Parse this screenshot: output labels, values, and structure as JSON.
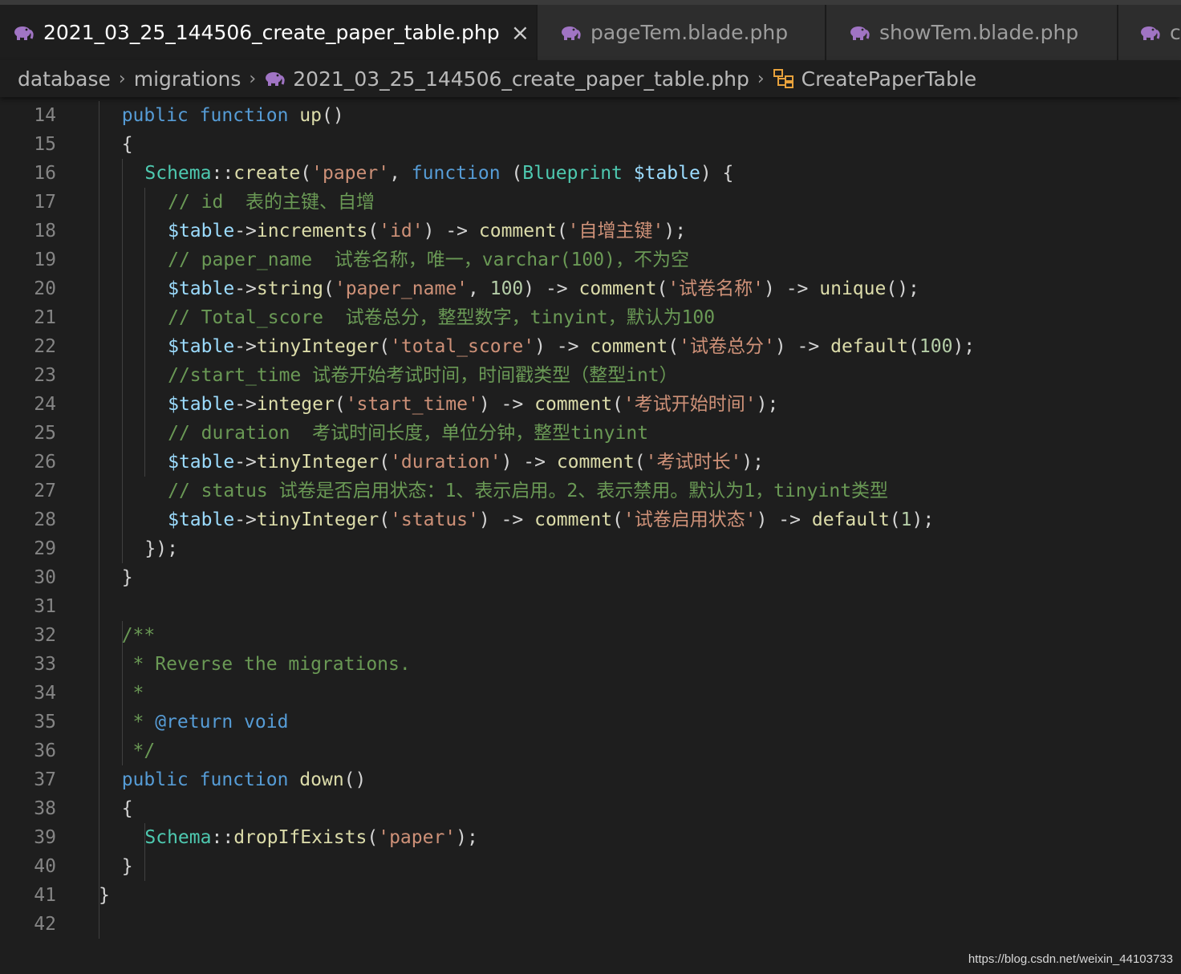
{
  "tabs": [
    {
      "label": "2021_03_25_144506_create_paper_table.php",
      "active": true,
      "icon": "php-elephant-icon"
    },
    {
      "label": "pageTem.blade.php",
      "active": false,
      "icon": "php-elephant-icon"
    },
    {
      "label": "showTem.blade.php",
      "active": false,
      "icon": "php-elephant-icon"
    },
    {
      "label": "c",
      "active": false,
      "icon": "php-elephant-icon"
    }
  ],
  "tab_close_glyph": "×",
  "breadcrumb": {
    "items": [
      "database",
      "migrations",
      "2021_03_25_144506_create_paper_table.php",
      "CreatePaperTable"
    ],
    "separator": "›"
  },
  "code_lines": [
    {
      "num": "14",
      "indent": 2,
      "tokens": [
        [
          "kw",
          "public"
        ],
        [
          "pn",
          " "
        ],
        [
          "kw",
          "function"
        ],
        [
          "pn",
          " "
        ],
        [
          "fn",
          "up"
        ],
        [
          "pn",
          "()"
        ]
      ]
    },
    {
      "num": "15",
      "indent": 2,
      "tokens": [
        [
          "pn",
          "{"
        ]
      ]
    },
    {
      "num": "16",
      "indent": 4,
      "tokens": [
        [
          "cls",
          "Schema"
        ],
        [
          "pn",
          "::"
        ],
        [
          "fn",
          "create"
        ],
        [
          "pn",
          "("
        ],
        [
          "str",
          "'paper'"
        ],
        [
          "pn",
          ", "
        ],
        [
          "kw",
          "function"
        ],
        [
          "pn",
          " ("
        ],
        [
          "cls",
          "Blueprint"
        ],
        [
          "pn",
          " "
        ],
        [
          "var",
          "$table"
        ],
        [
          "pn",
          ") {"
        ]
      ]
    },
    {
      "num": "17",
      "indent": 6,
      "tokens": [
        [
          "cm",
          "// id  表的主键、自增"
        ]
      ]
    },
    {
      "num": "18",
      "indent": 6,
      "tokens": [
        [
          "var",
          "$table"
        ],
        [
          "pn",
          "->"
        ],
        [
          "fn",
          "increments"
        ],
        [
          "pn",
          "("
        ],
        [
          "str",
          "'id'"
        ],
        [
          "pn",
          ") -> "
        ],
        [
          "fn",
          "comment"
        ],
        [
          "pn",
          "("
        ],
        [
          "str",
          "'自增主键'"
        ],
        [
          "pn",
          ");"
        ]
      ]
    },
    {
      "num": "19",
      "indent": 6,
      "tokens": [
        [
          "cm",
          "// paper_name  试卷名称，唯一，varchar(100)，不为空"
        ]
      ]
    },
    {
      "num": "20",
      "indent": 6,
      "tokens": [
        [
          "var",
          "$table"
        ],
        [
          "pn",
          "->"
        ],
        [
          "fn",
          "string"
        ],
        [
          "pn",
          "("
        ],
        [
          "str",
          "'paper_name'"
        ],
        [
          "pn",
          ", "
        ],
        [
          "num",
          "100"
        ],
        [
          "pn",
          ") -> "
        ],
        [
          "fn",
          "comment"
        ],
        [
          "pn",
          "("
        ],
        [
          "str",
          "'试卷名称'"
        ],
        [
          "pn",
          ") -> "
        ],
        [
          "fn",
          "unique"
        ],
        [
          "pn",
          "();"
        ]
      ]
    },
    {
      "num": "21",
      "indent": 6,
      "tokens": [
        [
          "cm",
          "// Total_score  试卷总分，整型数字，tinyint，默认为100"
        ]
      ]
    },
    {
      "num": "22",
      "indent": 6,
      "tokens": [
        [
          "var",
          "$table"
        ],
        [
          "pn",
          "->"
        ],
        [
          "fn",
          "tinyInteger"
        ],
        [
          "pn",
          "("
        ],
        [
          "str",
          "'total_score'"
        ],
        [
          "pn",
          ") -> "
        ],
        [
          "fn",
          "comment"
        ],
        [
          "pn",
          "("
        ],
        [
          "str",
          "'试卷总分'"
        ],
        [
          "pn",
          ") -> "
        ],
        [
          "fn",
          "default"
        ],
        [
          "pn",
          "("
        ],
        [
          "num",
          "100"
        ],
        [
          "pn",
          ");"
        ]
      ]
    },
    {
      "num": "23",
      "indent": 6,
      "tokens": [
        [
          "cm",
          "//start_time 试卷开始考试时间，时间戳类型（整型int）"
        ]
      ]
    },
    {
      "num": "24",
      "indent": 6,
      "tokens": [
        [
          "var",
          "$table"
        ],
        [
          "pn",
          "->"
        ],
        [
          "fn",
          "integer"
        ],
        [
          "pn",
          "("
        ],
        [
          "str",
          "'start_time'"
        ],
        [
          "pn",
          ") -> "
        ],
        [
          "fn",
          "comment"
        ],
        [
          "pn",
          "("
        ],
        [
          "str",
          "'考试开始时间'"
        ],
        [
          "pn",
          ");"
        ]
      ]
    },
    {
      "num": "25",
      "indent": 6,
      "tokens": [
        [
          "cm",
          "// duration  考试时间长度，单位分钟，整型tinyint"
        ]
      ]
    },
    {
      "num": "26",
      "indent": 6,
      "tokens": [
        [
          "var",
          "$table"
        ],
        [
          "pn",
          "->"
        ],
        [
          "fn",
          "tinyInteger"
        ],
        [
          "pn",
          "("
        ],
        [
          "str",
          "'duration'"
        ],
        [
          "pn",
          ") -> "
        ],
        [
          "fn",
          "comment"
        ],
        [
          "pn",
          "("
        ],
        [
          "str",
          "'考试时长'"
        ],
        [
          "pn",
          ");"
        ]
      ]
    },
    {
      "num": "27",
      "indent": 6,
      "tokens": [
        [
          "cm",
          "// status 试卷是否启用状态：1、表示启用。2、表示禁用。默认为1，tinyint类型"
        ]
      ]
    },
    {
      "num": "28",
      "indent": 6,
      "tokens": [
        [
          "var",
          "$table"
        ],
        [
          "pn",
          "->"
        ],
        [
          "fn",
          "tinyInteger"
        ],
        [
          "pn",
          "("
        ],
        [
          "str",
          "'status'"
        ],
        [
          "pn",
          ") -> "
        ],
        [
          "fn",
          "comment"
        ],
        [
          "pn",
          "("
        ],
        [
          "str",
          "'试卷启用状态'"
        ],
        [
          "pn",
          ") -> "
        ],
        [
          "fn",
          "default"
        ],
        [
          "pn",
          "("
        ],
        [
          "num",
          "1"
        ],
        [
          "pn",
          ");"
        ]
      ]
    },
    {
      "num": "29",
      "indent": 4,
      "tokens": [
        [
          "pn",
          "});"
        ]
      ]
    },
    {
      "num": "30",
      "indent": 2,
      "tokens": [
        [
          "pn",
          "}"
        ]
      ]
    },
    {
      "num": "31",
      "indent": 0,
      "tokens": []
    },
    {
      "num": "32",
      "indent": 2,
      "tokens": [
        [
          "cm",
          "/**"
        ]
      ]
    },
    {
      "num": "33",
      "indent": 2,
      "tokens": [
        [
          "cm",
          " * Reverse the migrations."
        ]
      ]
    },
    {
      "num": "34",
      "indent": 2,
      "tokens": [
        [
          "cm",
          " *"
        ]
      ]
    },
    {
      "num": "35",
      "indent": 2,
      "tokens": [
        [
          "cm",
          " * "
        ],
        [
          "kw",
          "@return"
        ],
        [
          "pn",
          " "
        ],
        [
          "kw",
          "void"
        ]
      ]
    },
    {
      "num": "36",
      "indent": 2,
      "tokens": [
        [
          "cm",
          " */"
        ]
      ]
    },
    {
      "num": "37",
      "indent": 2,
      "tokens": [
        [
          "kw",
          "public"
        ],
        [
          "pn",
          " "
        ],
        [
          "kw",
          "function"
        ],
        [
          "pn",
          " "
        ],
        [
          "fn",
          "down"
        ],
        [
          "pn",
          "()"
        ]
      ]
    },
    {
      "num": "38",
      "indent": 2,
      "tokens": [
        [
          "pn",
          "{"
        ]
      ]
    },
    {
      "num": "39",
      "indent": 4,
      "tokens": [
        [
          "cls",
          "Schema"
        ],
        [
          "pn",
          "::"
        ],
        [
          "fn",
          "dropIfExists"
        ],
        [
          "pn",
          "("
        ],
        [
          "str",
          "'paper'"
        ],
        [
          "pn",
          ");"
        ]
      ]
    },
    {
      "num": "40",
      "indent": 2,
      "tokens": [
        [
          "pn",
          "}"
        ]
      ]
    },
    {
      "num": "41",
      "indent": 0,
      "tokens": [
        [
          "pn",
          "}"
        ]
      ]
    },
    {
      "num": "42",
      "indent": 0,
      "tokens": []
    }
  ],
  "watermark": "https://blog.csdn.net/weixin_44103733",
  "colors": {
    "background": "#1e1e1e",
    "keyword": "#569cd6",
    "function": "#dcdcaa",
    "class": "#4ec9b0",
    "string": "#ce9178",
    "variable": "#9cdcfe",
    "number": "#b5cea8",
    "comment": "#6a9955",
    "php_icon": "#a074c4",
    "symbol_icon": "#e8a23c"
  }
}
